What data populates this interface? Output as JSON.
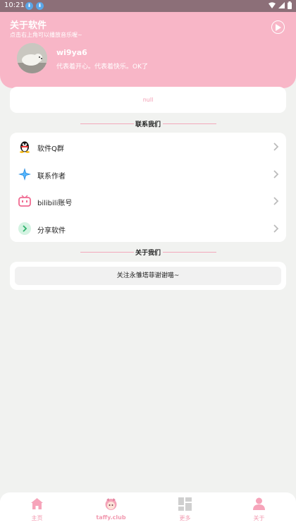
{
  "status_bar": {
    "time": "10:21"
  },
  "header": {
    "title": "关于软件",
    "subtitle": "点击右上角可以播放音乐喔~",
    "user": {
      "name": "wi9ya6",
      "signature": "代表着开心。代表着快乐。OK了"
    }
  },
  "null_card": {
    "text": "null"
  },
  "contact": {
    "title": "联系我们",
    "items": [
      {
        "label": "软件Q群",
        "icon": "qq-penguin-icon"
      },
      {
        "label": "联系作者",
        "icon": "sparkle-icon"
      },
      {
        "label": "bilibili账号",
        "icon": "bilibili-tv-icon"
      },
      {
        "label": "分享软件",
        "icon": "share-arrow-icon"
      }
    ]
  },
  "about": {
    "title": "关于我们",
    "text": "关注永雏塔菲谢谢喵~"
  },
  "bottom_nav": [
    {
      "label": "主页",
      "icon": "home-icon"
    },
    {
      "label": "taffy.club",
      "icon": "taffy-avatar-icon"
    },
    {
      "label": "更多",
      "icon": "grid-icon"
    },
    {
      "label": "关于",
      "icon": "person-icon"
    }
  ],
  "colors": {
    "accent_pink": "#f8b6c7",
    "text_pink": "#f29ab0",
    "background": "#f1f2f0"
  }
}
